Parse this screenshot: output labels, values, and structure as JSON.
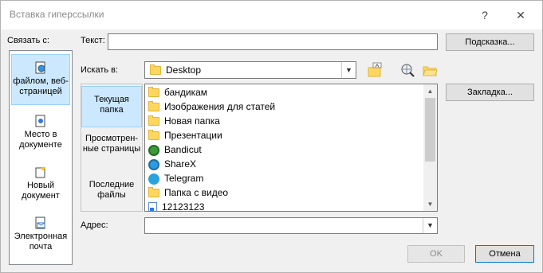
{
  "dialog": {
    "title": "Вставка гиперссылки",
    "help_label": "?",
    "close_label": "✕"
  },
  "link_to": {
    "label": "Связать с:",
    "items": [
      {
        "label": "файлом, веб-страницей",
        "selected": true
      },
      {
        "label": "Место в документе",
        "selected": false
      },
      {
        "label": "Новый документ",
        "selected": false
      },
      {
        "label": "Электронная почта",
        "selected": false
      }
    ]
  },
  "text": {
    "label": "Текст:",
    "value": "",
    "tooltip_button": "Подсказка..."
  },
  "look_in": {
    "label": "Искать в:",
    "value": "Desktop"
  },
  "places": [
    {
      "label": "Текущая папка",
      "selected": true
    },
    {
      "label": "Просмотрен-ные страницы",
      "selected": false
    },
    {
      "label": "Последние файлы",
      "selected": false
    }
  ],
  "files": [
    {
      "name": "бандикам",
      "icon": "folder-icon"
    },
    {
      "name": "Изображения для статей",
      "icon": "folder-icon"
    },
    {
      "name": "Новая папка",
      "icon": "folder-icon"
    },
    {
      "name": "Презентации",
      "icon": "folder-icon"
    },
    {
      "name": "Bandicut",
      "icon": "bandicut-shortcut-icon"
    },
    {
      "name": "ShareX",
      "icon": "sharex-shortcut-icon"
    },
    {
      "name": "Telegram",
      "icon": "telegram-shortcut-icon"
    },
    {
      "name": "Папка с видео",
      "icon": "folder-shortcut-icon"
    },
    {
      "name": "12123123",
      "icon": "document-icon"
    }
  ],
  "bookmark_button": "Закладка...",
  "address": {
    "label": "Адрес:",
    "value": ""
  },
  "buttons": {
    "ok": "OK",
    "cancel": "Отмена"
  },
  "colors": {
    "selection": "#cce8ff",
    "folder": "#ffd75e",
    "accent": "#0078d7"
  }
}
